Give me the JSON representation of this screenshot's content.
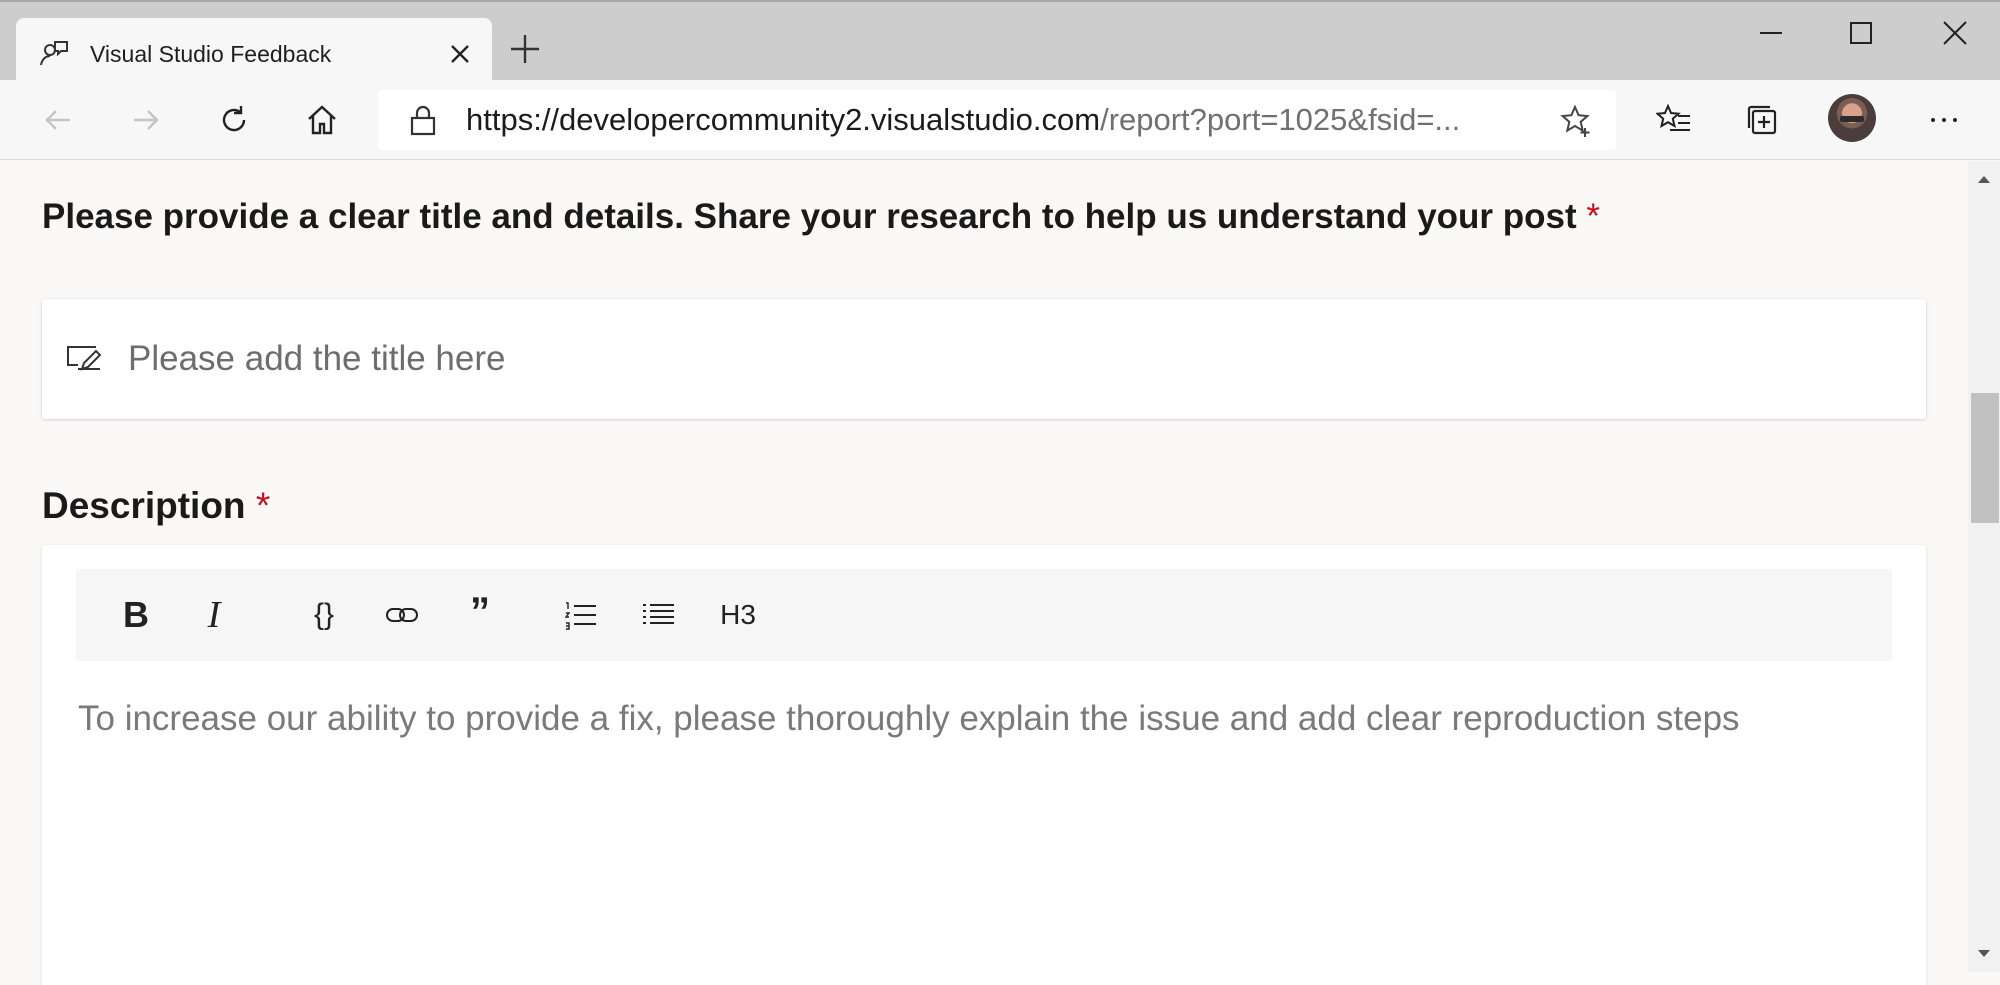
{
  "browser": {
    "tab": {
      "title": "Visual Studio Feedback",
      "icon": "feedback-person-icon"
    },
    "address_bar": {
      "url_domain": "https://developercommunity2.visualstudio.com",
      "url_path": "/report?port=1025&fsid=..."
    },
    "icons": [
      "back-icon",
      "forward-icon",
      "refresh-icon",
      "home-icon",
      "lock-icon",
      "add-favorite-icon",
      "favorites-icon",
      "collections-icon",
      "profile-avatar",
      "more-icon",
      "minimize-icon",
      "maximize-icon",
      "close-icon",
      "new-tab-icon"
    ]
  },
  "form": {
    "section_title": "Please provide a clear title and details. Share your research to help us understand your post",
    "required_marker": "*",
    "title_placeholder": "Please add the title here",
    "description_label": "Description",
    "description_placeholder": "To increase our ability to provide a fix, please thoroughly explain the issue and add clear reproduction steps",
    "format_toolbar": {
      "bold": "B",
      "italic": "I",
      "code": "{}",
      "quote": "”",
      "heading": "H3"
    }
  },
  "colors": {
    "required": "#c50f1f",
    "page_bg": "#faf9f8",
    "titlebar_bg": "#cdcdcd"
  }
}
